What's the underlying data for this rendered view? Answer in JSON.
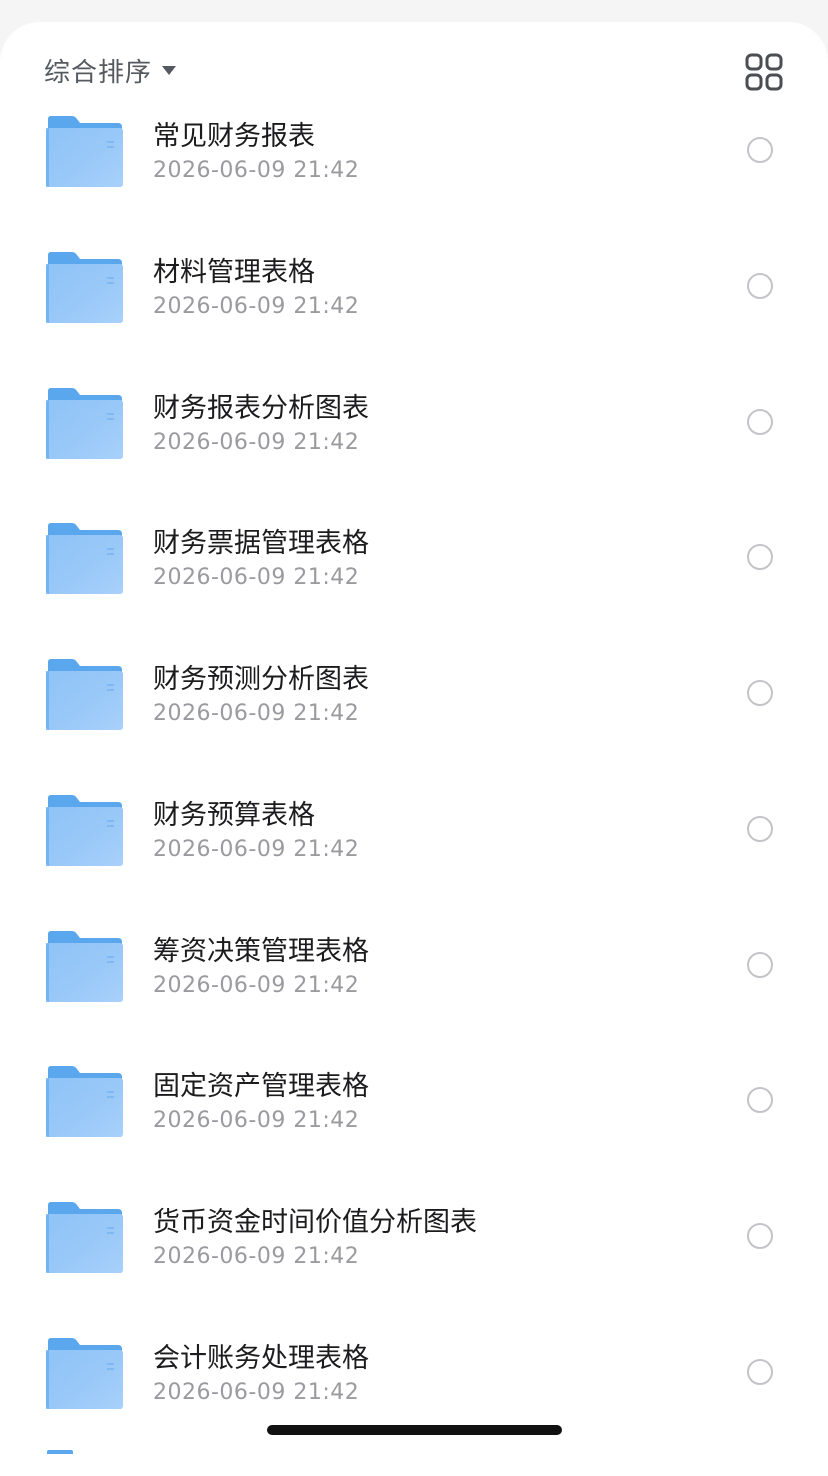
{
  "toolbar": {
    "sort_label": "综合排序",
    "sort_icon": "caret-down-icon",
    "view_toggle_icon": "grid-view-icon"
  },
  "colors": {
    "folder_back": "#5aa7ee",
    "folder_front": "#a9d1fb",
    "title_text": "#1c1c1e",
    "date_text": "#9a9a9f",
    "checkbox_border": "#c4c4c8"
  },
  "files": [
    {
      "name": "常见财务报表",
      "date": "2026-06-09 21:42",
      "icon": "folder-icon"
    },
    {
      "name": "材料管理表格",
      "date": "2026-06-09 21:42",
      "icon": "folder-icon"
    },
    {
      "name": "财务报表分析图表",
      "date": "2026-06-09 21:42",
      "icon": "folder-icon"
    },
    {
      "name": "财务票据管理表格",
      "date": "2026-06-09 21:42",
      "icon": "folder-icon"
    },
    {
      "name": "财务预测分析图表",
      "date": "2026-06-09 21:42",
      "icon": "folder-icon"
    },
    {
      "name": "财务预算表格",
      "date": "2026-06-09 21:42",
      "icon": "folder-icon"
    },
    {
      "name": "筹资决策管理表格",
      "date": "2026-06-09 21:42",
      "icon": "folder-icon"
    },
    {
      "name": "固定资产管理表格",
      "date": "2026-06-09 21:42",
      "icon": "folder-icon"
    },
    {
      "name": "货币资金时间价值分析图表",
      "date": "2026-06-09 21:42",
      "icon": "folder-icon"
    },
    {
      "name": "会计账务处理表格",
      "date": "2026-06-09 21:42",
      "icon": "folder-icon"
    }
  ]
}
